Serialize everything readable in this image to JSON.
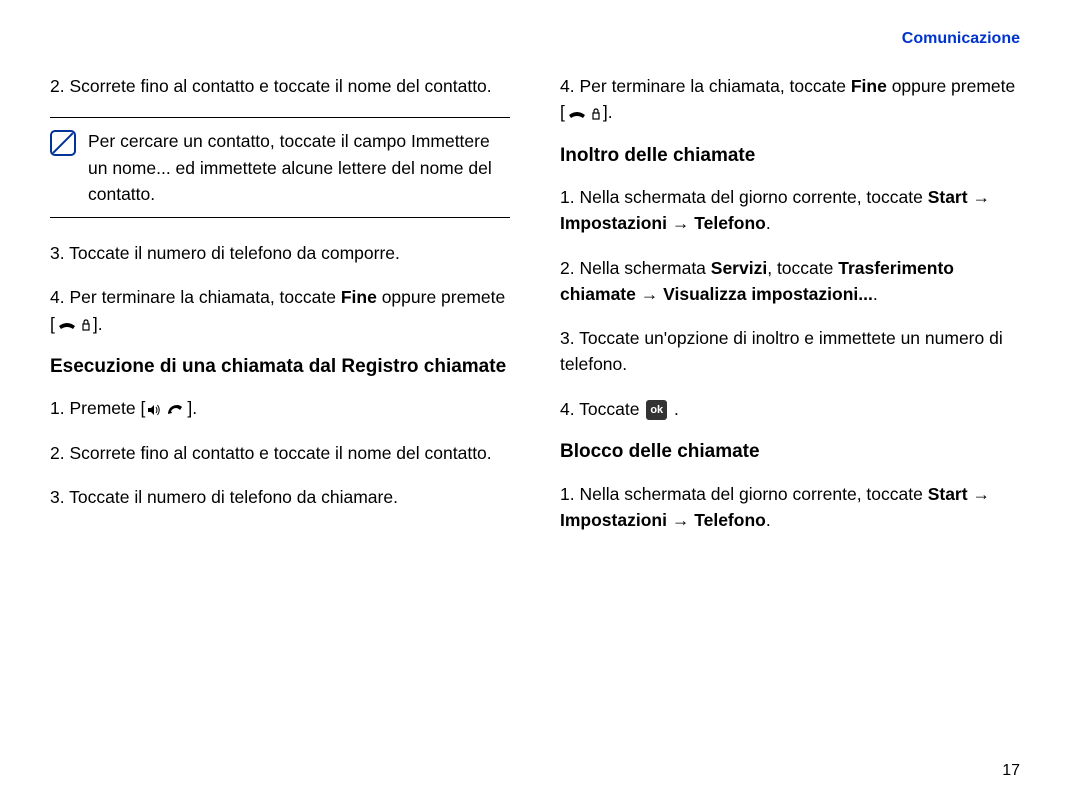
{
  "header": "Comunicazione",
  "left": {
    "step2": "Scorrete fino al contatto e toccate il nome del contatto.",
    "note": "Per cercare un contatto, toccate il campo Immettere un nome... ed immettete alcune lettere del nome del contatto.",
    "step3": "Toccate il numero di telefono da comporre.",
    "step4_pre": "Per terminare la chiamata, toccate ",
    "step4_bold": "Fine",
    "step4_post": " oppure premete [",
    "step4_end": "].",
    "heading1": "Esecuzione di una chiamata dal Registro chiamate",
    "h1_step1_pre": "Premete [",
    "h1_step1_post": "].",
    "h1_step2": "Scorrete fino al contatto e toccate il nome del contatto.",
    "h1_step3": "Toccate il numero di telefono da chiamare."
  },
  "right": {
    "step4_pre": "Per terminare la chiamata, toccate ",
    "step4_bold": "Fine",
    "step4_post": " oppure premete [",
    "step4_end": "].",
    "heading2": "Inoltro delle chiamate",
    "i_step1_pre": "Nella schermata del giorno corrente, toccate ",
    "i_step1_path1": "Start",
    "i_step1_path2": "Impostazioni",
    "i_step1_path3": "Telefono",
    "i_step2_pre": "Nella schermata ",
    "i_step2_servizi": "Servizi",
    "i_step2_mid": ", toccate ",
    "i_step2_path1": "Trasferimento chiamate",
    "i_step2_path2": "Visualizza impostazioni...",
    "i_step3": "Toccate un'opzione di inoltro e immettete un numero di telefono.",
    "i_step4": "Toccate ",
    "ok_label": "ok",
    "heading3": "Blocco delle chiamate",
    "b_step1_pre": "Nella schermata del giorno corrente, toccate ",
    "b_step1_path1": "Start",
    "b_step1_path2": "Impostazioni",
    "b_step1_path3": "Telefono"
  },
  "arrow": "→",
  "period": ".",
  "page_number": "17"
}
